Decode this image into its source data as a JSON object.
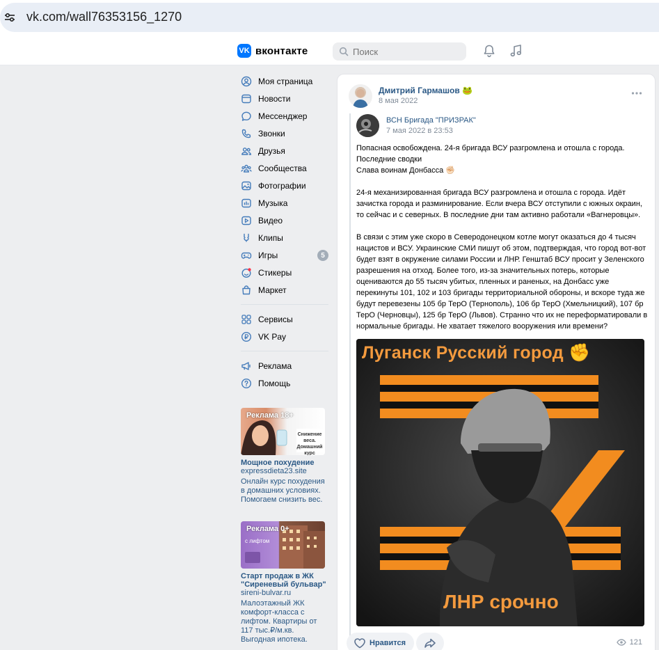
{
  "browser": {
    "url": "vk.com/wall76353156_1270"
  },
  "header": {
    "logo_text": "вконтакте",
    "logo_mark": "VK",
    "search_placeholder": "Поиск",
    "icons": [
      "bell-icon",
      "music-icon"
    ]
  },
  "nav": {
    "items": [
      {
        "label": "Моя страница",
        "icon": "user-circle-icon"
      },
      {
        "label": "Новости",
        "icon": "news-icon"
      },
      {
        "label": "Мессенджер",
        "icon": "message-icon"
      },
      {
        "label": "Звонки",
        "icon": "phone-icon"
      },
      {
        "label": "Друзья",
        "icon": "friends-icon"
      },
      {
        "label": "Сообщества",
        "icon": "communities-icon"
      },
      {
        "label": "Фотографии",
        "icon": "photo-icon"
      },
      {
        "label": "Музыка",
        "icon": "music-icon"
      },
      {
        "label": "Видео",
        "icon": "video-icon"
      },
      {
        "label": "Клипы",
        "icon": "clips-icon"
      },
      {
        "label": "Игры",
        "icon": "games-icon",
        "badge": "5"
      },
      {
        "label": "Стикеры",
        "icon": "stickers-icon"
      }
    ],
    "market": {
      "label": "Маркет",
      "icon": "bag-icon"
    },
    "services": [
      {
        "label": "Сервисы",
        "icon": "grid-icon"
      },
      {
        "label": "VK Pay",
        "icon": "ruble-icon"
      }
    ],
    "bottom": [
      {
        "label": "Реклама",
        "icon": "megaphone-icon"
      },
      {
        "label": "Помощь",
        "icon": "help-icon"
      }
    ]
  },
  "ads": [
    {
      "label": "Реклама 18+",
      "image_caption": "Снижение веса. Домашний курс",
      "title": "Мощное похудение",
      "domain": "expressdieta23.site",
      "desc": "Онлайн курс похудения в домашних условиях. Помогаем снизить вес."
    },
    {
      "label": "Реклама 0+",
      "image_caption": "с лифтом",
      "title": "Старт продаж в ЖК \"Сиреневый бульвар\"",
      "domain": "sireni-bulvar.ru",
      "desc": "Малоэтажный ЖК комфорт-класса с лифтом. Квартиры от 117 тыс.₽/м.кв. Выгодная ипотека."
    }
  ],
  "post": {
    "author": "Дмитрий Гармашов 🐸",
    "date": "8 мая 2022",
    "repost": {
      "source": "ВСН Бригада \"ПРИЗРАК\"",
      "date": "7 мая 2022 в 23:53"
    },
    "paragraphs": [
      "Попасная освобождена. 24-я бригада ВСУ разгромлена и отошла с города.",
      "Последние сводки",
      "Слава воинам Донбасса ✊🏻",
      "",
      "24-я механизированная бригада ВСУ разгромлена и отошла с города. Идёт зачистка города и разминирование. Если вчера ВСУ отступили с южных окраин, то сейчас и с северных. В последние дни там активно работали «Вагнеровцы».",
      "",
      "В связи с этим уже скоро в Северодонецком котле могут оказаться до 4 тысяч нацистов и ВСУ. Украинские СМИ пишут об этом, подтверждая, что город вот-вот будет взят в окружение силами России и ЛНР. Генштаб ВСУ просит у Зеленского разрешения на отход. Более того, из-за значительных потерь, которые оцениваются до 55 тысяч убитых, пленных и раненых, на Донбасс уже перекинуты 101, 102 и 103 бригады территориальной обороны, и вскоре туда же будут перевезены 105 бр ТерО (Тернополь), 106 бр ТерО (Хмельницкий), 107 бр ТерО (Черновцы), 125 бр ТерО (Львов). Странно что их не переформатировали в нормальные бригады. Не хватает тяжелого вооружения или времени?"
    ],
    "image": {
      "title": "Луганск Русский город ✊",
      "bottom": "ЛНР срочно"
    },
    "like_label": "Нравится",
    "views": "121"
  },
  "colors": {
    "accent": "#2a5885",
    "vk_blue": "#0077ff",
    "poster_orange": "#f39a3e"
  }
}
